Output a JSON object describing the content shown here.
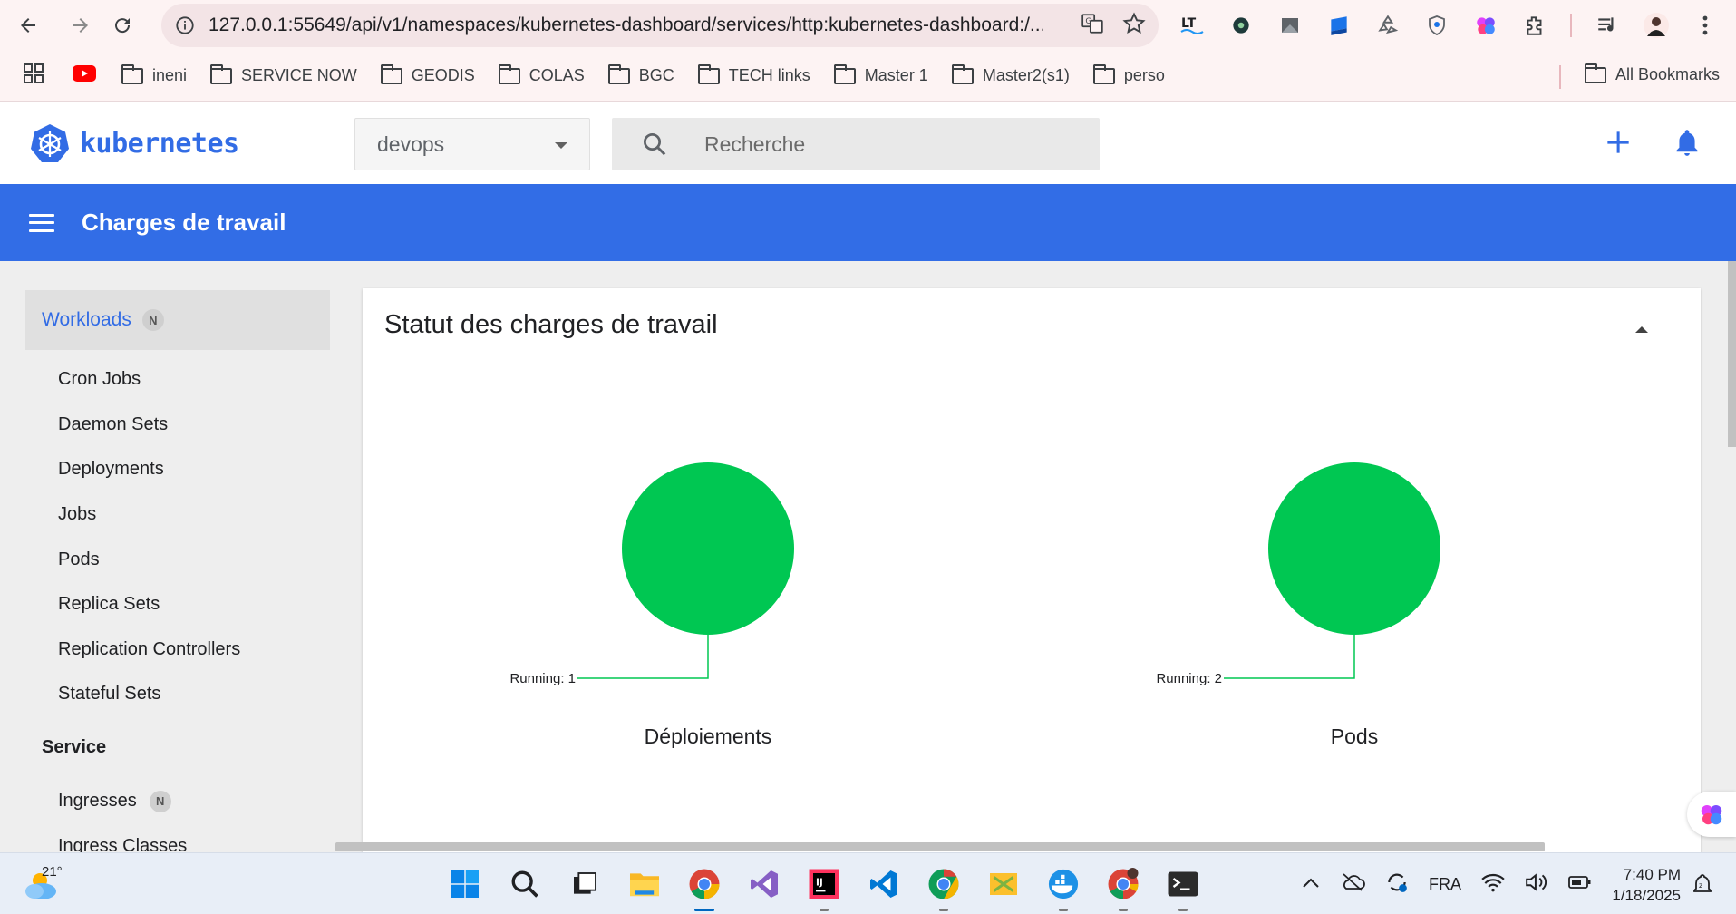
{
  "browser": {
    "url": "127.0.0.1:55649/api/v1/namespaces/kubernetes-dashboard/services/http:kubernetes-dashboard:/...",
    "bookmarks": [
      "ineni",
      "SERVICE NOW",
      "GEODIS",
      "COLAS",
      "BGC",
      "TECH links",
      "Master 1",
      "Master2(s1)",
      "perso"
    ],
    "all_bookmarks": "All Bookmarks",
    "extensions": [
      "lt-icon",
      "puzzle-gear-icon",
      "arrow-extension-icon",
      "blue-extension-icon",
      "recycle-icon",
      "shield-icon",
      "brain-icon",
      "extensions-puzzle-icon",
      "playlist-icon",
      "profile-avatar"
    ]
  },
  "header": {
    "logo_text": "kubernetes",
    "namespace": "devops",
    "search_placeholder": "Recherche"
  },
  "toolbar": {
    "title": "Charges de travail"
  },
  "sidebar": {
    "active": {
      "label": "Workloads",
      "badge": "N"
    },
    "items": [
      "Cron Jobs",
      "Daemon Sets",
      "Deployments",
      "Jobs",
      "Pods",
      "Replica Sets",
      "Replication Controllers",
      "Stateful Sets"
    ],
    "section": "Service",
    "service_items": [
      {
        "label": "Ingresses",
        "badge": "N"
      },
      {
        "label": "Ingress Classes",
        "badge": ""
      }
    ]
  },
  "card": {
    "title": "Statut des charges de travail"
  },
  "chart_data": [
    {
      "type": "pie",
      "title": "Déploiements",
      "labels": [
        "Running"
      ],
      "values": [
        1
      ],
      "slice_labels": [
        "Running: 1"
      ],
      "colors": [
        "#00c752"
      ]
    },
    {
      "type": "pie",
      "title": "Pods",
      "labels": [
        "Running"
      ],
      "values": [
        2
      ],
      "slice_labels": [
        "Running: 2"
      ],
      "colors": [
        "#00c752"
      ]
    }
  ],
  "taskbar": {
    "temperature": "21°",
    "apps": [
      "windows-start-icon",
      "search-icon",
      "task-view-icon",
      "file-explorer-icon",
      "chrome-icon",
      "visual-studio-icon",
      "intellij-icon",
      "vscode-icon",
      "chrome-canary-icon",
      "k8s-tool-icon",
      "docker-icon",
      "chrome-profile-icon",
      "terminal-icon"
    ],
    "language": "FRA",
    "time": "7:40 PM",
    "date": "1/18/2025"
  }
}
